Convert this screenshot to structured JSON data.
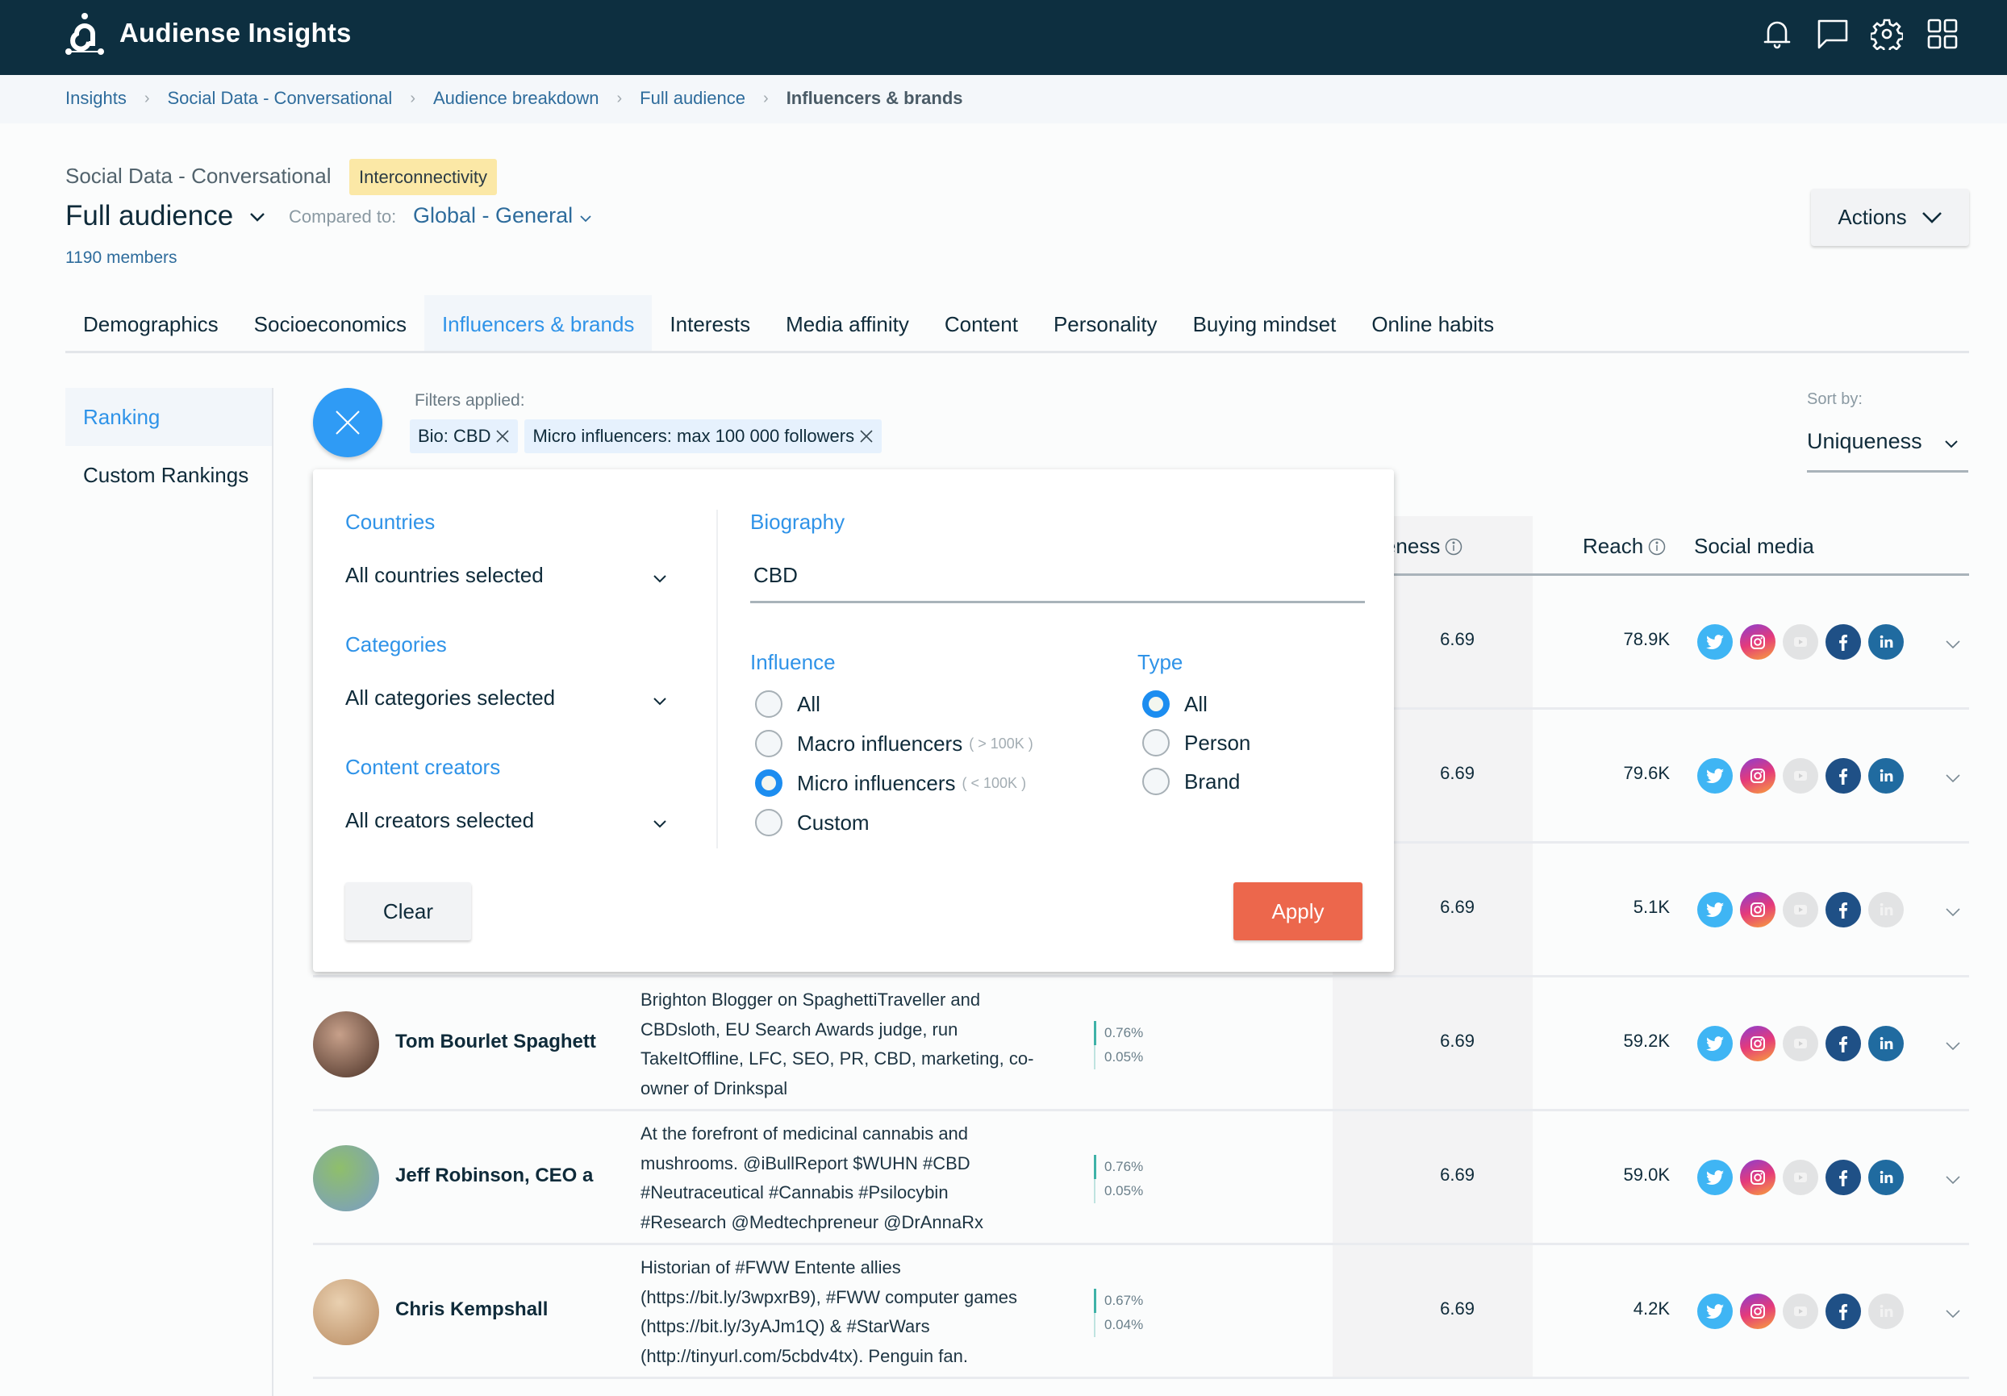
{
  "header": {
    "app_title": "Audiense Insights",
    "icons": [
      "bell-icon",
      "chat-icon",
      "gear-icon",
      "apps-grid-icon"
    ]
  },
  "breadcrumb": [
    {
      "label": "Insights"
    },
    {
      "label": "Social Data - Conversational"
    },
    {
      "label": "Audience breakdown"
    },
    {
      "label": "Full audience"
    },
    {
      "label": "Influencers & brands",
      "current": true
    }
  ],
  "report": {
    "project": "Social Data - Conversational",
    "badge": "Interconnectivity",
    "audience": "Full audience",
    "compared_label": "Compared to:",
    "compared_value": "Global - General",
    "members": "1190 members",
    "actions_label": "Actions"
  },
  "tabs": [
    {
      "label": "Demographics"
    },
    {
      "label": "Socioeconomics"
    },
    {
      "label": "Influencers & brands",
      "active": true
    },
    {
      "label": "Interests"
    },
    {
      "label": "Media affinity"
    },
    {
      "label": "Content"
    },
    {
      "label": "Personality"
    },
    {
      "label": "Buying mindset"
    },
    {
      "label": "Online habits"
    }
  ],
  "sidebar": {
    "items": [
      {
        "label": "Ranking",
        "active": true
      },
      {
        "label": "Custom Rankings"
      }
    ]
  },
  "filters": {
    "applied_label": "Filters applied:",
    "chips": [
      "Bio: CBD",
      "Micro influencers: max 100 000 followers"
    ]
  },
  "sort": {
    "label": "Sort by:",
    "value": "Uniqueness"
  },
  "filter_panel": {
    "countries": {
      "label": "Countries",
      "value": "All countries selected"
    },
    "categories": {
      "label": "Categories",
      "value": "All categories selected"
    },
    "creators": {
      "label": "Content creators",
      "value": "All creators selected"
    },
    "biography": {
      "label": "Biography",
      "value": "CBD"
    },
    "influence": {
      "label": "Influence",
      "options": [
        {
          "label": "All",
          "hint": "",
          "checked": false
        },
        {
          "label": "Macro influencers",
          "hint": "( > 100K )",
          "checked": false
        },
        {
          "label": "Micro influencers",
          "hint": "( < 100K )",
          "checked": true
        },
        {
          "label": "Custom",
          "hint": "",
          "checked": false
        }
      ]
    },
    "type": {
      "label": "Type",
      "options": [
        {
          "label": "All",
          "checked": true
        },
        {
          "label": "Person",
          "checked": false
        },
        {
          "label": "Brand",
          "checked": false
        }
      ]
    },
    "clear_label": "Clear",
    "apply_label": "Apply"
  },
  "table": {
    "columns": {
      "uniqueness": "Uniqueness",
      "reach": "Reach",
      "social": "Social media"
    },
    "rows": [
      {
        "name": "",
        "bio": [],
        "pct1": "",
        "pct2": "",
        "uniqueness": "6.69",
        "reach": "78.9K",
        "social": {
          "twitter": true,
          "instagram": true,
          "youtube": false,
          "facebook": true,
          "linkedin": true
        }
      },
      {
        "name": "",
        "bio": [],
        "pct1": "",
        "pct2": "",
        "uniqueness": "6.69",
        "reach": "79.6K",
        "social": {
          "twitter": true,
          "instagram": true,
          "youtube": false,
          "facebook": true,
          "linkedin": true
        }
      },
      {
        "name": "",
        "bio": [],
        "pct1": "",
        "pct2": "",
        "uniqueness": "6.69",
        "reach": "5.1K",
        "social": {
          "twitter": true,
          "instagram": true,
          "youtube": false,
          "facebook": true,
          "linkedin": false
        }
      },
      {
        "name": "Tom Bourlet Spaghett",
        "bio": [
          "Brighton Blogger on SpaghettiTraveller and",
          "CBDsloth, EU Search Awards judge, run",
          "TakeItOffline, LFC, SEO, PR, CBD, marketing, co-",
          "owner of Drinkspal"
        ],
        "pct1": "0.76%",
        "pct2": "0.05%",
        "uniqueness": "6.69",
        "reach": "59.2K",
        "social": {
          "twitter": true,
          "instagram": true,
          "youtube": false,
          "facebook": true,
          "linkedin": true
        }
      },
      {
        "name": "Jeff Robinson, CEO a",
        "bio": [
          "At the forefront of medicinal cannabis and",
          "mushrooms. @iBullReport $WUHN #CBD",
          "#Neutraceutical #Cannabis #Psilocybin",
          "#Research @Medtechpreneur @DrAnnaRx"
        ],
        "pct1": "0.76%",
        "pct2": "0.05%",
        "uniqueness": "6.69",
        "reach": "59.0K",
        "social": {
          "twitter": true,
          "instagram": true,
          "youtube": false,
          "facebook": true,
          "linkedin": true
        }
      },
      {
        "name": "Chris Kempshall",
        "bio": [
          "Historian of #FWW Entente allies",
          "(https://bit.ly/3wpxrB9), #FWW computer games",
          "(https://bit.ly/3yAJm1Q) & #StarWars",
          "(http://tinyurl.com/5cbdv4tx). Penguin fan."
        ],
        "pct1": "0.67%",
        "pct2": "0.04%",
        "uniqueness": "6.69",
        "reach": "4.2K",
        "social": {
          "twitter": true,
          "instagram": true,
          "youtube": false,
          "facebook": true,
          "linkedin": false
        }
      }
    ]
  },
  "colors": {
    "header_bg": "#0d2f40",
    "accent_blue": "#2f93e8",
    "link_blue": "#2e6c9c",
    "apply_orange": "#ec674c",
    "badge_yellow": "#fbe8a6",
    "twitter": "#3fb5f4",
    "facebook": "#1f5086",
    "linkedin": "#206ba0",
    "disabled": "#e2e3e4"
  }
}
